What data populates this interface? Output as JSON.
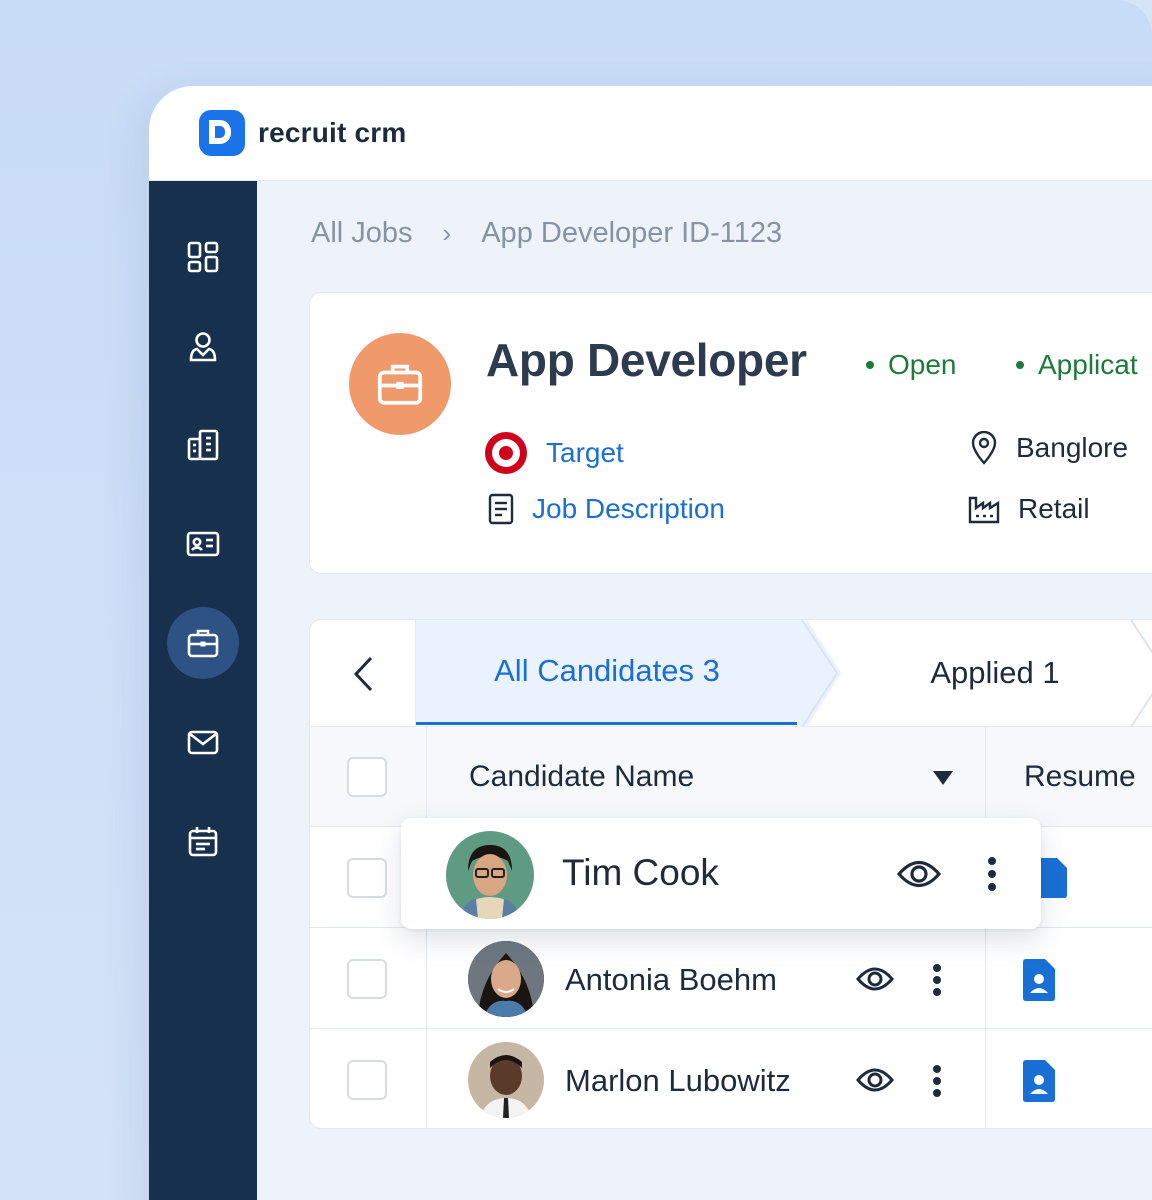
{
  "app": {
    "name": "recruit crm"
  },
  "breadcrumb": {
    "root": "All Jobs",
    "separator": "›",
    "current": "App Developer ID-1123"
  },
  "job": {
    "title": "App Developer",
    "statuses": [
      "Open",
      "Applicat"
    ],
    "company": "Target",
    "description_link": "Job Description",
    "location": "Banglore",
    "industry": "Retail",
    "accent_color": "#f0996a"
  },
  "sidebar": {
    "items": [
      {
        "icon": "dashboard-icon",
        "active": false
      },
      {
        "icon": "candidates-icon",
        "active": false
      },
      {
        "icon": "companies-icon",
        "active": false
      },
      {
        "icon": "contacts-icon",
        "active": false
      },
      {
        "icon": "jobs-icon",
        "active": true
      },
      {
        "icon": "mail-icon",
        "active": false
      },
      {
        "icon": "calendar-icon",
        "active": false
      }
    ]
  },
  "pipeline": {
    "tabs": [
      {
        "label": "All Candidates 3",
        "active": true
      },
      {
        "label": "Applied 1",
        "active": false
      }
    ],
    "columns": {
      "name": "Candidate Name",
      "resume": "Resume"
    },
    "candidates": [
      {
        "name": "Tim Cook",
        "highlighted": true
      },
      {
        "name": "Antonia Boehm",
        "highlighted": false
      },
      {
        "name": "Marlon Lubowitz",
        "highlighted": false
      }
    ]
  },
  "colors": {
    "primary": "#1a73e8",
    "sidebar": "#16304e",
    "status_green": "#1e7a3a",
    "link": "#1a6fd4"
  }
}
